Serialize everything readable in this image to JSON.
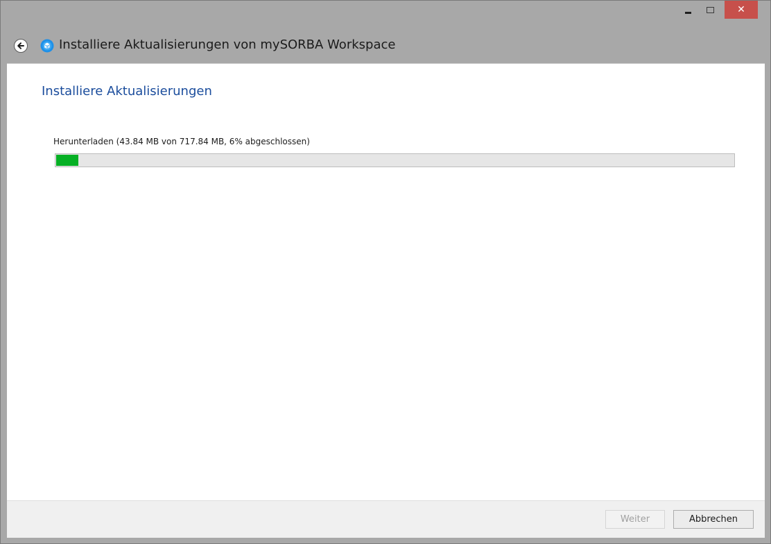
{
  "window": {
    "title": "Installiere Aktualisierungen von mySORBA Workspace",
    "controls": {
      "minimize_icon": "minimize-icon",
      "maximize_icon": "maximize-icon",
      "close_glyph": "✕",
      "close_color": "#c7504b"
    }
  },
  "header": {
    "back_icon": "back-arrow-icon",
    "app_icon": "mysorba-app-icon"
  },
  "main": {
    "heading": "Installiere Aktualisierungen",
    "heading_color": "#1a4c9c",
    "status_text": "Herunterladen (43.84 MB von 717.84 MB, 6% abgeschlossen)",
    "progress": {
      "percent": 6,
      "downloaded": "43.84 MB",
      "total": "717.84 MB",
      "fill_color": "#06b025"
    }
  },
  "footer": {
    "next_label": "Weiter",
    "next_enabled": false,
    "cancel_label": "Abbrechen"
  }
}
